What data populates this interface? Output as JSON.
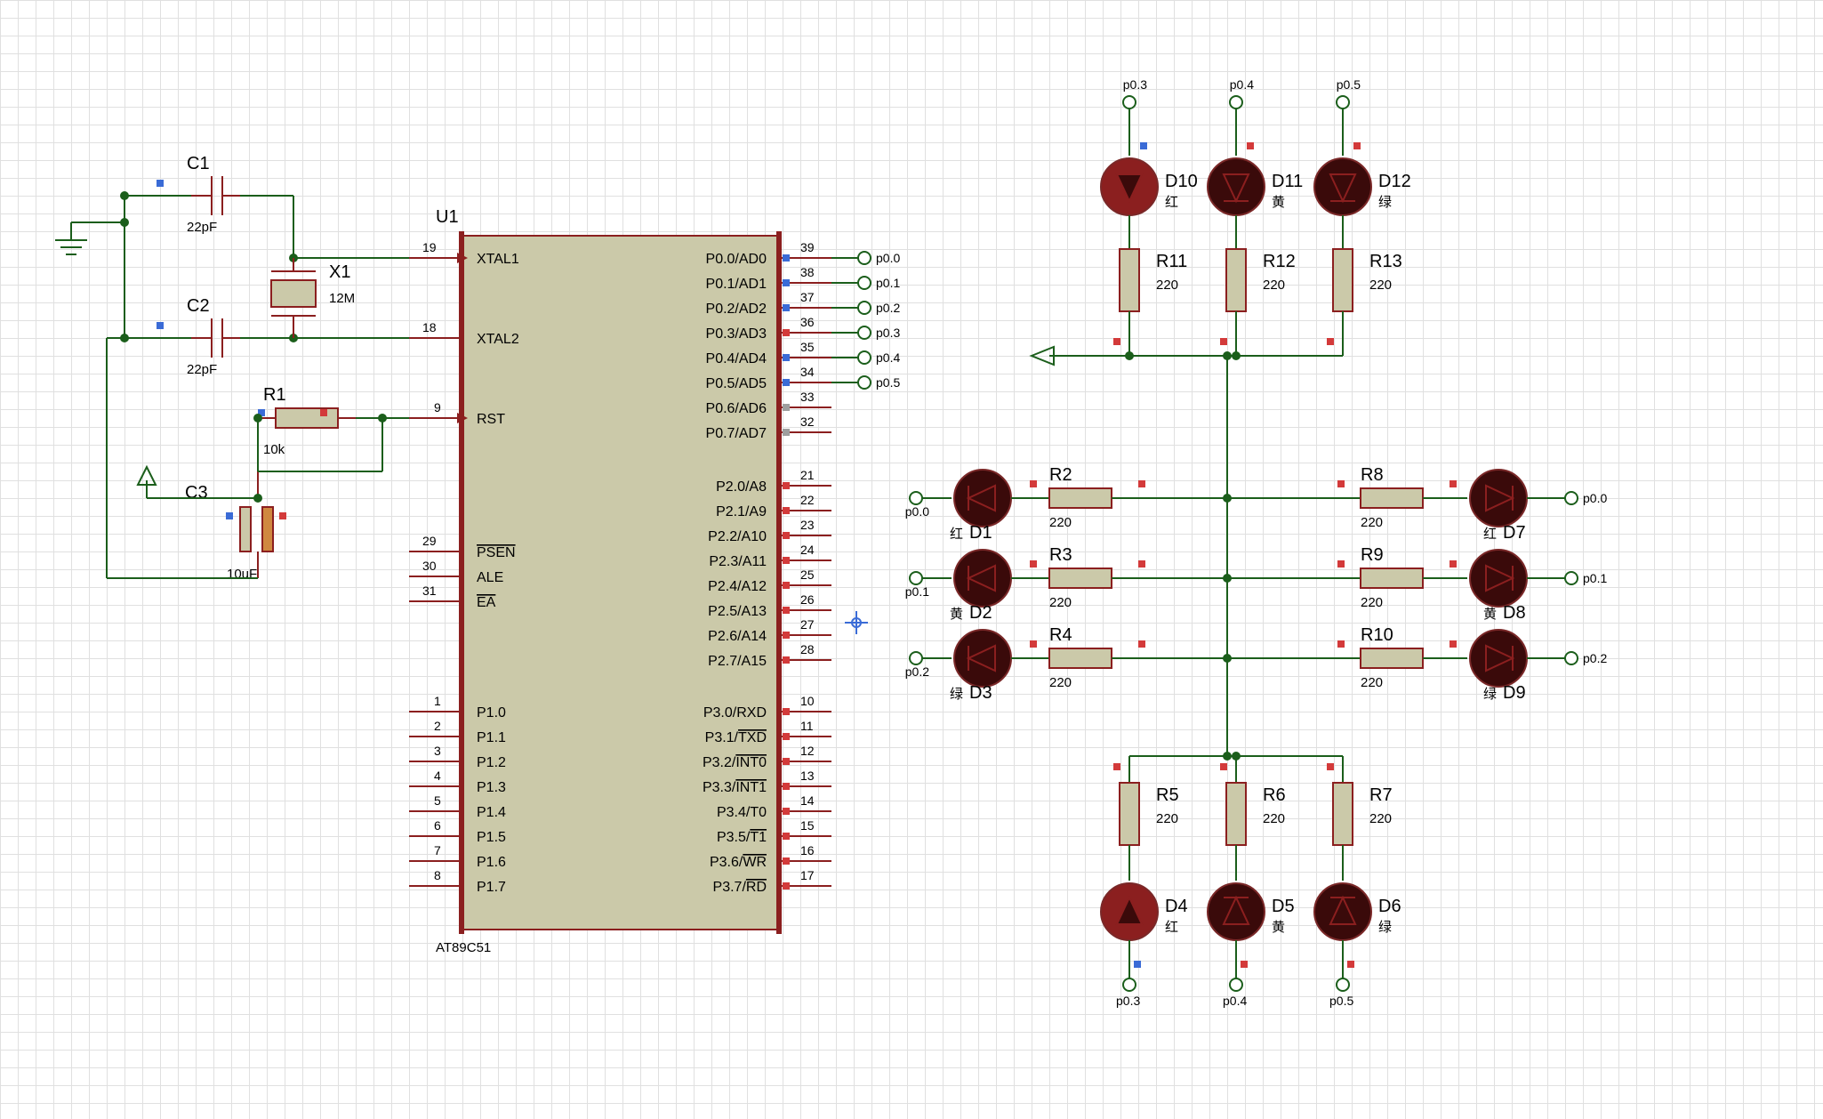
{
  "ic": {
    "ref": "U1",
    "part": "AT89C51",
    "pins_left": [
      {
        "num": "19",
        "name": "XTAL1"
      },
      {
        "num": "18",
        "name": "XTAL2"
      },
      {
        "num": "9",
        "name": "RST"
      },
      {
        "num": "29",
        "name": "PSEN",
        "ov": true
      },
      {
        "num": "30",
        "name": "ALE"
      },
      {
        "num": "31",
        "name": "EA",
        "ov": true
      },
      {
        "num": "1",
        "name": "P1.0"
      },
      {
        "num": "2",
        "name": "P1.1"
      },
      {
        "num": "3",
        "name": "P1.2"
      },
      {
        "num": "4",
        "name": "P1.3"
      },
      {
        "num": "5",
        "name": "P1.4"
      },
      {
        "num": "6",
        "name": "P1.5"
      },
      {
        "num": "7",
        "name": "P1.6"
      },
      {
        "num": "8",
        "name": "P1.7"
      }
    ],
    "pins_right": [
      {
        "num": "39",
        "name": "P0.0/AD0"
      },
      {
        "num": "38",
        "name": "P0.1/AD1"
      },
      {
        "num": "37",
        "name": "P0.2/AD2"
      },
      {
        "num": "36",
        "name": "P0.3/AD3"
      },
      {
        "num": "35",
        "name": "P0.4/AD4"
      },
      {
        "num": "34",
        "name": "P0.5/AD5"
      },
      {
        "num": "33",
        "name": "P0.6/AD6"
      },
      {
        "num": "32",
        "name": "P0.7/AD7"
      },
      {
        "num": "21",
        "name": "P2.0/A8"
      },
      {
        "num": "22",
        "name": "P2.1/A9"
      },
      {
        "num": "23",
        "name": "P2.2/A10"
      },
      {
        "num": "24",
        "name": "P2.3/A11"
      },
      {
        "num": "25",
        "name": "P2.4/A12"
      },
      {
        "num": "26",
        "name": "P2.5/A13"
      },
      {
        "num": "27",
        "name": "P2.6/A14"
      },
      {
        "num": "28",
        "name": "P2.7/A15"
      },
      {
        "num": "10",
        "name": "P3.0/RXD"
      },
      {
        "num": "11",
        "name": "P3.1/TXD",
        "ov": "TXD"
      },
      {
        "num": "12",
        "name": "P3.2/INT0",
        "ov": "INT0"
      },
      {
        "num": "13",
        "name": "P3.3/INT1",
        "ov": "INT1"
      },
      {
        "num": "14",
        "name": "P3.4/T0"
      },
      {
        "num": "15",
        "name": "P3.5/T1",
        "ov": "T1"
      },
      {
        "num": "16",
        "name": "P3.6/WR",
        "ov": "WR"
      },
      {
        "num": "17",
        "name": "P3.7/RD",
        "ov": "RD"
      }
    ]
  },
  "top_nets": [
    "p0.0",
    "p0.1",
    "p0.2",
    "p0.3",
    "p0.4",
    "p0.5"
  ],
  "caps": {
    "C1": {
      "ref": "C1",
      "val": "22pF"
    },
    "C2": {
      "ref": "C2",
      "val": "22pF"
    },
    "C3": {
      "ref": "C3",
      "val": "10uF"
    }
  },
  "xtal": {
    "ref": "X1",
    "val": "12M"
  },
  "r1": {
    "ref": "R1",
    "val": "10k"
  },
  "lights_top": [
    {
      "net": "p0.3",
      "led": "D10",
      "color": "红",
      "res": "R11",
      "rval": "220",
      "on": true
    },
    {
      "net": "p0.4",
      "led": "D11",
      "color": "黄",
      "res": "R12",
      "rval": "220",
      "on": false
    },
    {
      "net": "p0.5",
      "led": "D12",
      "color": "绿",
      "res": "R13",
      "rval": "220",
      "on": false
    }
  ],
  "lights_left": [
    {
      "net": "p0.0",
      "led": "D1",
      "color": "红",
      "res": "R2",
      "rval": "220"
    },
    {
      "net": "p0.1",
      "led": "D2",
      "color": "黄",
      "res": "R3",
      "rval": "220"
    },
    {
      "net": "p0.2",
      "led": "D3",
      "color": "绿",
      "res": "R4",
      "rval": "220"
    }
  ],
  "lights_right": [
    {
      "net": "p0.0",
      "led": "D7",
      "color": "红",
      "res": "R8",
      "rval": "220"
    },
    {
      "net": "p0.1",
      "led": "D8",
      "color": "黄",
      "res": "R9",
      "rval": "220"
    },
    {
      "net": "p0.2",
      "led": "D9",
      "color": "绿",
      "res": "R10",
      "rval": "220"
    }
  ],
  "lights_bottom": [
    {
      "net": "p0.3",
      "led": "D4",
      "color": "红",
      "res": "R5",
      "rval": "220",
      "on": true
    },
    {
      "net": "p0.4",
      "led": "D5",
      "color": "黄",
      "res": "R6",
      "rval": "220",
      "on": false
    },
    {
      "net": "p0.5",
      "led": "D6",
      "color": "绿",
      "res": "R7",
      "rval": "220",
      "on": false
    }
  ]
}
